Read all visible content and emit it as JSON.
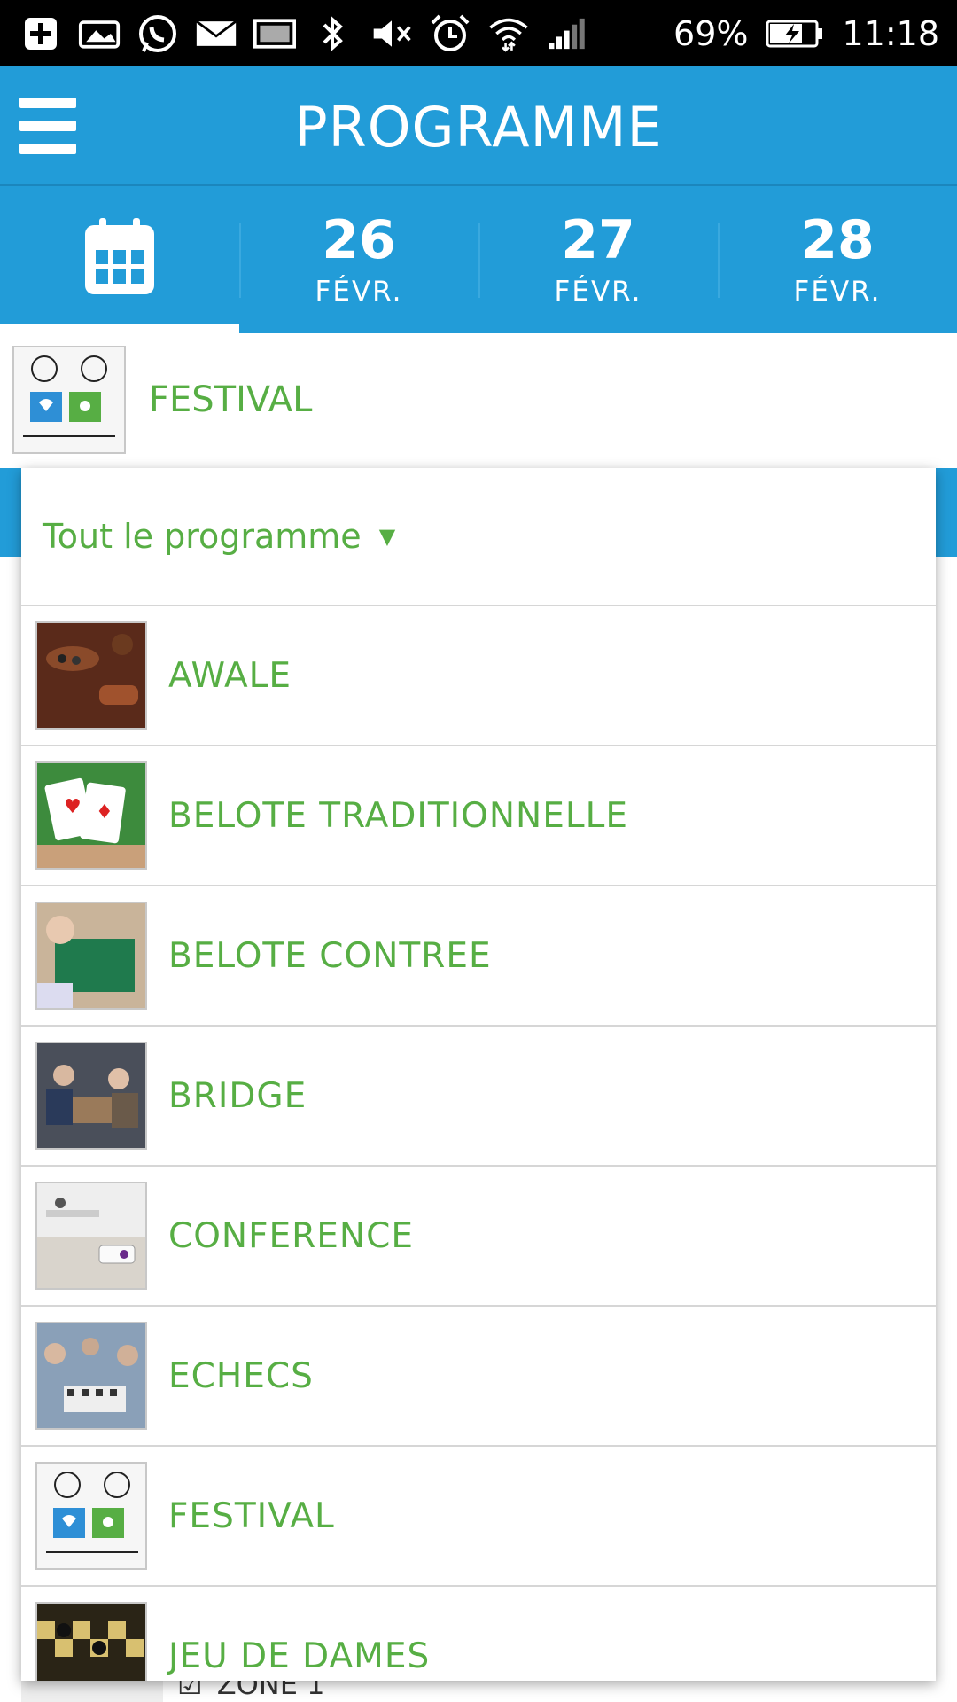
{
  "status_bar": {
    "battery": "69%",
    "time": "11:18",
    "icons": [
      "add-icon",
      "image-icon",
      "whatsapp-icon",
      "mail-icon",
      "photo-icon",
      "bluetooth-icon",
      "mute-icon",
      "alarm-icon",
      "wifi-icon",
      "signal-icon",
      "battery-icon"
    ]
  },
  "header": {
    "title": "PROGRAMME"
  },
  "date_tabs": [
    {
      "day": "26",
      "month": "FÉVR."
    },
    {
      "day": "27",
      "month": "FÉVR."
    },
    {
      "day": "28",
      "month": "FÉVR."
    }
  ],
  "selected_category": {
    "label": "FESTIVAL"
  },
  "dropdown": {
    "selected": "Tout le programme",
    "items": [
      {
        "label": "AWALE"
      },
      {
        "label": "BELOTE TRADITIONNELLE"
      },
      {
        "label": "BELOTE CONTREE"
      },
      {
        "label": "BRIDGE"
      },
      {
        "label": "CONFERENCE"
      },
      {
        "label": "ECHECS"
      },
      {
        "label": "FESTIVAL"
      },
      {
        "label": "JEU DE DAMES"
      }
    ]
  },
  "background_fragment": {
    "zone": "ZONE 1"
  },
  "colors": {
    "primary_blue": "#229cd8",
    "accent_green": "#57ae44"
  }
}
